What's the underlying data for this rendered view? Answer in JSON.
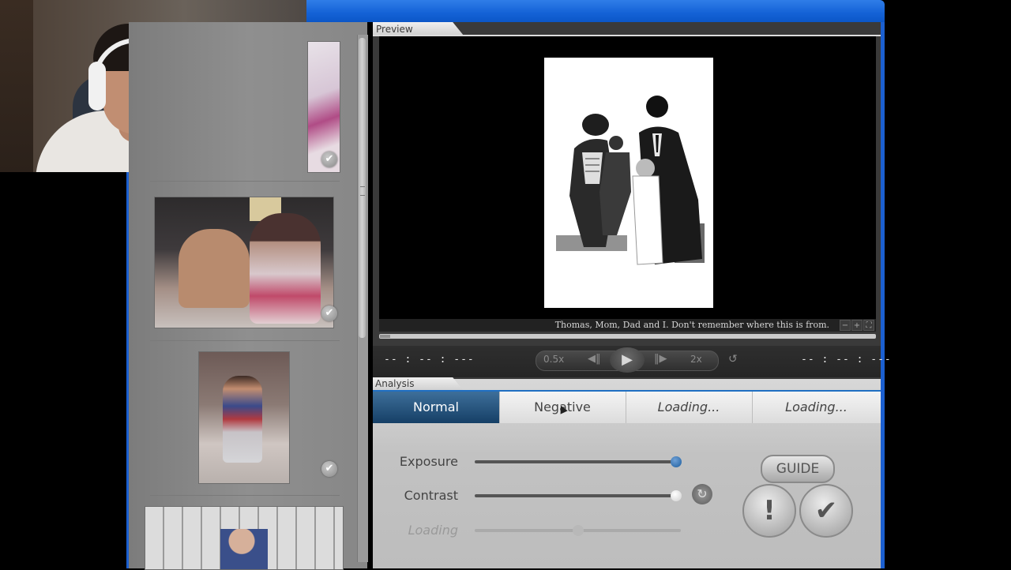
{
  "preview": {
    "tab_label": "Preview",
    "caption": "Thomas, Mom, Dad and I. Don't remember where this is from.",
    "caption_controls": [
      "−",
      "+",
      "⛶"
    ],
    "playback_progress": 0.02
  },
  "transport": {
    "time_left": "-- : -- : ---",
    "time_right": "-- : -- : ---",
    "slow_label": "0.5x",
    "fast_label": "2x",
    "icons": [
      "step-back-icon",
      "play-icon",
      "step-forward-icon",
      "loop-icon"
    ]
  },
  "analysis": {
    "tab_label": "Analysis",
    "modes": [
      "Normal",
      "Negative",
      "Loading...",
      "Loading..."
    ],
    "selected_mode": "Normal",
    "sliders": [
      {
        "label": "Exposure",
        "value": 0.99
      },
      {
        "label": "Contrast",
        "value": 0.99
      },
      {
        "label": "Loading",
        "value": 0.5
      }
    ],
    "guide_label": "GUIDE",
    "alert_glyph": "!",
    "ok_glyph": "✔",
    "reset_glyph": "↻"
  },
  "thumbnails": {
    "check_glyph": "✔",
    "items": [
      {
        "checked": true
      },
      {
        "checked": true
      },
      {
        "checked": true
      },
      {
        "checked": false
      }
    ]
  },
  "colors": {
    "titlebar_blue": "#1462d6",
    "selected_mode_bg": "#163f66",
    "exposure_knob": "#1d5e9e"
  }
}
